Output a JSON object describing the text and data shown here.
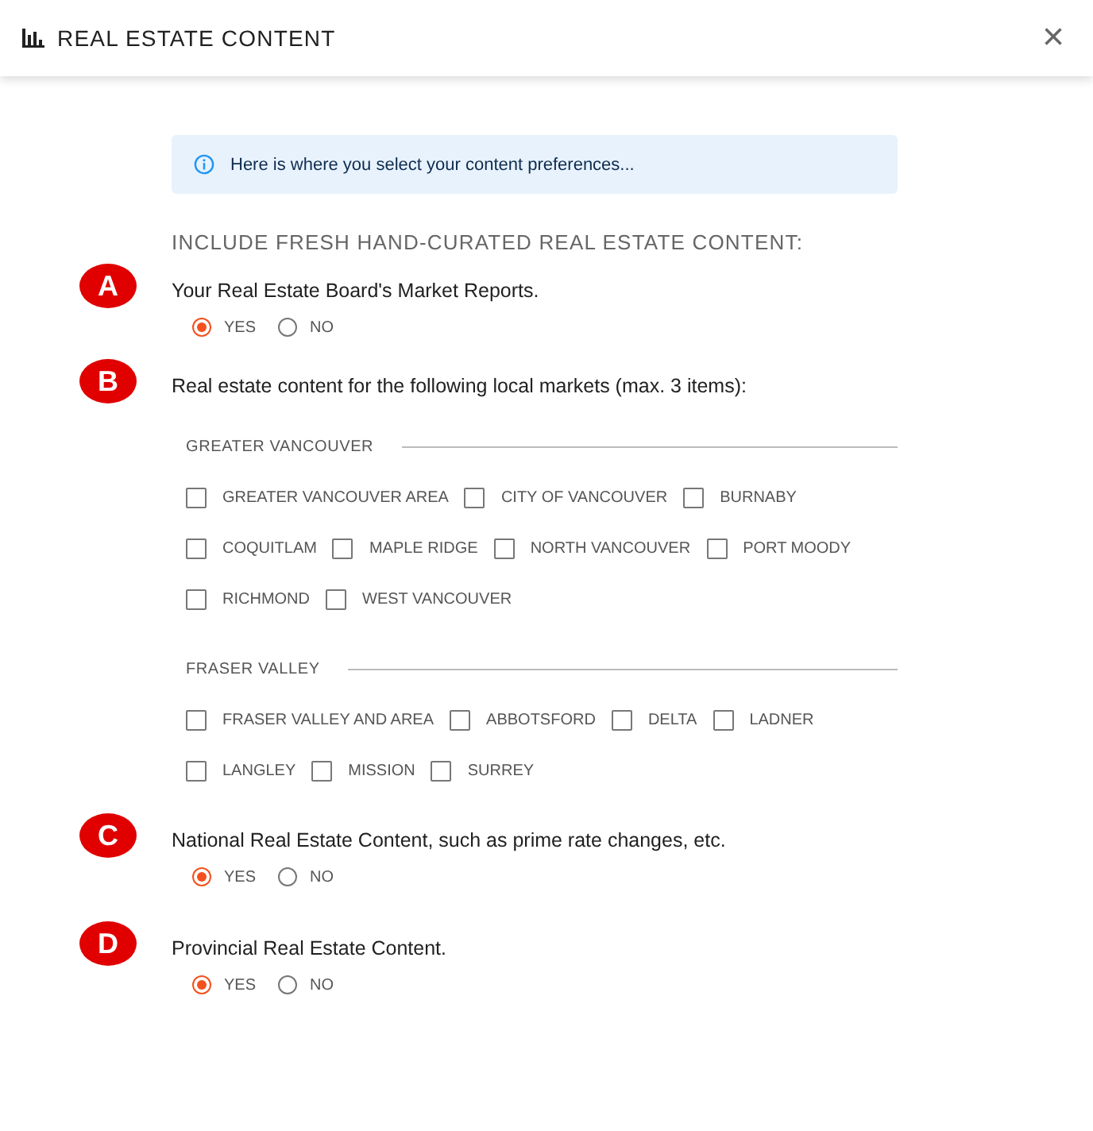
{
  "window": {
    "title": "REAL ESTATE CONTENT",
    "close": "×"
  },
  "info": "Here is where you select your content preferences...",
  "heading": "INCLUDE FRESH HAND-CURATED REAL ESTATE CONTENT:",
  "questions": [
    {
      "kind": "radio",
      "marker": "A",
      "text": "Your Real Estate Board's Market Reports.",
      "options": [
        {
          "label": "YES",
          "selected": true
        },
        {
          "label": "NO",
          "selected": false
        }
      ]
    },
    {
      "kind": "markets",
      "marker": "B",
      "text": "Real estate content for the following local markets (max. 3 items):",
      "groups": [
        {
          "title": "GREATER VANCOUVER",
          "options": [
            {
              "label": "GREATER VANCOUVER AREA",
              "checked": false
            },
            {
              "label": "CITY OF VANCOUVER",
              "checked": false
            },
            {
              "label": "BURNABY",
              "checked": false
            },
            {
              "label": "COQUITLAM",
              "checked": false
            },
            {
              "label": "MAPLE RIDGE",
              "checked": false
            },
            {
              "label": "NORTH VANCOUVER",
              "checked": false
            },
            {
              "label": "PORT MOODY",
              "checked": false
            },
            {
              "label": "RICHMOND",
              "checked": false
            },
            {
              "label": "WEST VANCOUVER",
              "checked": false
            }
          ]
        },
        {
          "title": "FRASER VALLEY",
          "options": [
            {
              "label": "FRASER VALLEY AND AREA",
              "checked": false
            },
            {
              "label": "ABBOTSFORD",
              "checked": false
            },
            {
              "label": "DELTA",
              "checked": false
            },
            {
              "label": "LADNER",
              "checked": false
            },
            {
              "label": "LANGLEY",
              "checked": false
            },
            {
              "label": "MISSION",
              "checked": false
            },
            {
              "label": "SURREY",
              "checked": false
            }
          ]
        }
      ]
    },
    {
      "kind": "radio",
      "marker": "C",
      "text": "National Real Estate Content, such as prime rate changes, etc.",
      "options": [
        {
          "label": "YES",
          "selected": true
        },
        {
          "label": "NO",
          "selected": false
        }
      ]
    },
    {
      "kind": "radio",
      "marker": "D",
      "text": "Provincial Real Estate Content.",
      "options": [
        {
          "label": "YES",
          "selected": true
        },
        {
          "label": "NO",
          "selected": false
        }
      ]
    }
  ]
}
